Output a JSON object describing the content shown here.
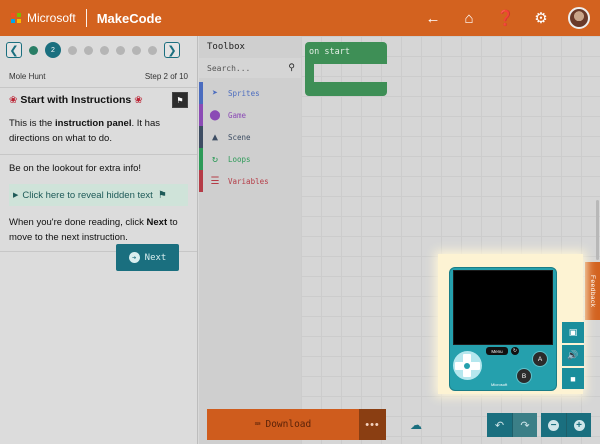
{
  "header": {
    "microsoft_label": "Microsoft",
    "product_label": "MakeCode",
    "icons": [
      "back-arrow-icon",
      "home-icon",
      "help-icon",
      "gear-icon",
      "avatar"
    ]
  },
  "tutorial": {
    "name": "Mole Hunt",
    "step_text": "Step 2 of 10",
    "current_step": "2",
    "title": "Start with Instructions",
    "para1_a": "This is the ",
    "para1_b": "instruction panel",
    "para1_c": ". It has directions on what to do.",
    "para2": "Be on the lookout for extra info!",
    "reveal_label": "Click here to reveal hidden text",
    "para3_a": "When you're done reading, click ",
    "para3_b": "Next",
    "para3_c": " to move to the next instruction.",
    "next_label": "Next"
  },
  "toolbox": {
    "title": "Toolbox",
    "search_placeholder": "Search...",
    "categories": [
      {
        "label": "Sprites",
        "color": "#4b6cbf",
        "icon": "paper-plane-icon"
      },
      {
        "label": "Game",
        "color": "#8b4bb5",
        "icon": "circle-icon"
      },
      {
        "label": "Scene",
        "color": "#3d4d63",
        "icon": "tree-icon"
      },
      {
        "label": "Loops",
        "color": "#2d9a58",
        "icon": "loop-icon"
      },
      {
        "label": "Variables",
        "color": "#b53c47",
        "icon": "list-icon"
      }
    ]
  },
  "workspace": {
    "block_label": "on start"
  },
  "bottom": {
    "download_label": "Download",
    "more_label": "•••"
  },
  "simulator": {
    "menu_label": "Menu",
    "a_label": "A",
    "b_label": "B",
    "brand_label": "Microsoft"
  },
  "feedback_label": "Feedback",
  "colors": {
    "header": "#d3621f",
    "accent": "#1a6f7f",
    "onstart_block": "#3e8f56",
    "simulator": "#25a0ad"
  }
}
